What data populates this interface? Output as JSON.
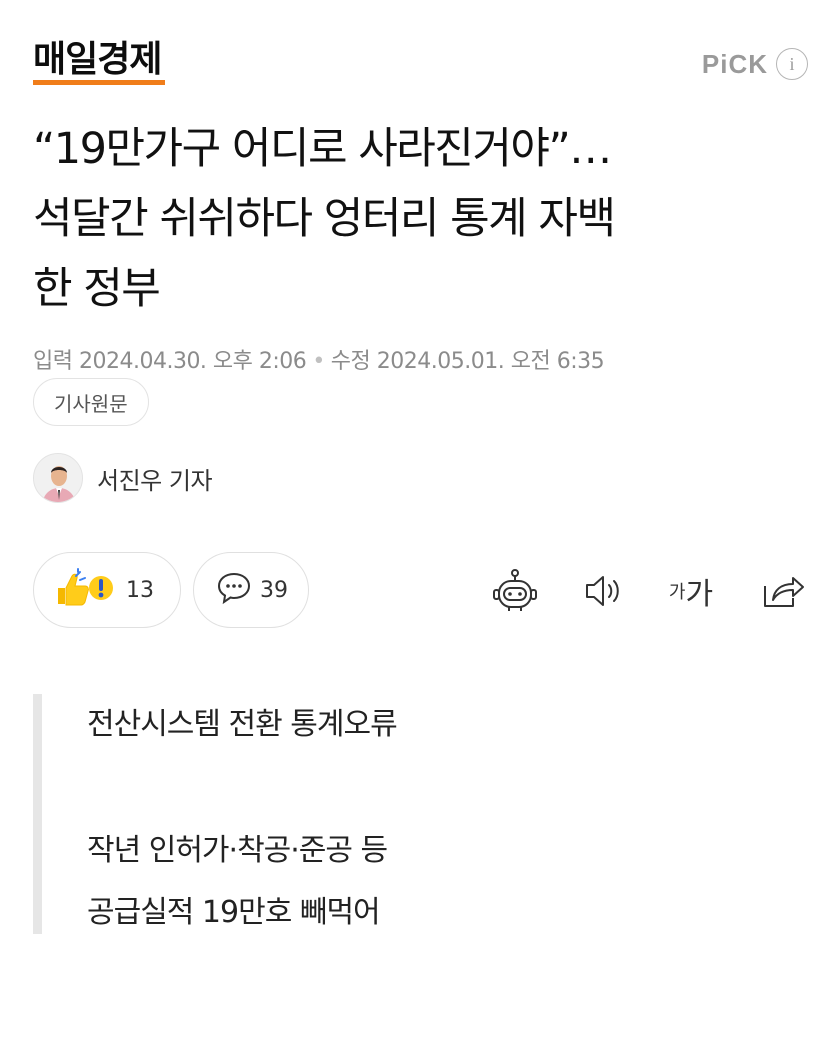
{
  "header": {
    "press_name": "매일경제",
    "pick_label": "PiCK",
    "info_glyph": "i"
  },
  "article": {
    "headline_lines": [
      "“19만가구 어디로 사라진거야”…",
      "석달간 쉬쉬하다 엉터리 통계 자백",
      "한 정부"
    ],
    "meta": {
      "published": "입력 2024.04.30. 오후 2:06",
      "modified": "수정 2024.05.01. 오전 6:35"
    },
    "origin_button": "기사원문",
    "reporter": "서진우 기자"
  },
  "actions": {
    "reaction_count": "13",
    "comment_count": "39",
    "font_size_small": "가",
    "font_size_big": "가"
  },
  "summary": {
    "lines": [
      "전산시스템 전환 통계오류",
      "작년 인허가·착공·준공 등",
      "공급실적 19만호 빼먹어"
    ]
  },
  "colors": {
    "press_accent": "#f07d1a",
    "muted_text": "#8b8b8b",
    "summary_bar": "#e6e6e6"
  },
  "icons": {
    "reaction": "thumbs-up-surprise-icon",
    "comment": "speech-bubble-icon",
    "summary_bot": "robot-icon",
    "tts": "speaker-icon",
    "font": "font-size-icon",
    "share": "share-icon",
    "info": "info-icon"
  }
}
